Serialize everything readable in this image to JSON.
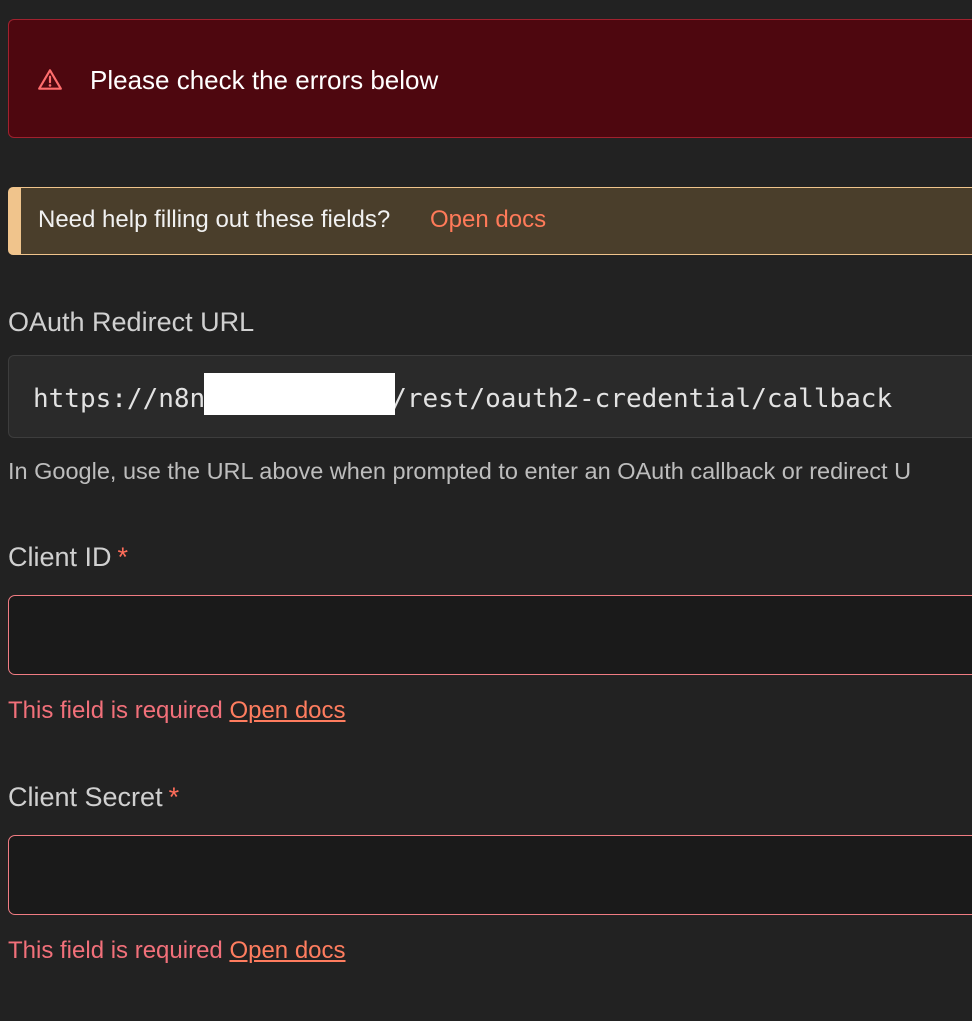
{
  "error_banner": {
    "icon": "warning-triangle-icon",
    "message": "Please check the errors below",
    "color": "#4e070f"
  },
  "help_callout": {
    "text": "Need help filling out these fields?",
    "link": "Open docs"
  },
  "redirect": {
    "label": "OAuth Redirect URL",
    "url_prefix": "https://n8n",
    "url_suffix": "/rest/oauth2-credential/callback",
    "hint": "In Google, use the URL above when prompted to enter an OAuth callback or redirect U"
  },
  "client_id": {
    "label": "Client ID",
    "required_mark": "*",
    "value": "",
    "error": "This field is required",
    "error_link": "Open docs"
  },
  "client_secret": {
    "label": "Client Secret",
    "required_mark": "*",
    "value": "",
    "error": "This field is required",
    "error_link": "Open docs"
  },
  "colors": {
    "accent": "#ff6d5a",
    "error": "#f2707a",
    "callout_border": "#f0c48c"
  }
}
